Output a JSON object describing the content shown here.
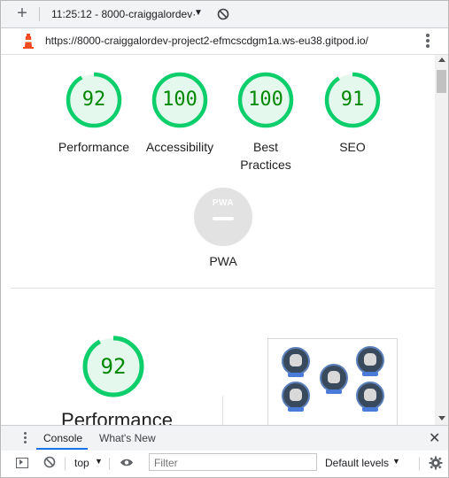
{
  "toolbar": {
    "plus_label": "+",
    "session_title": "11:25:12 - 8000-craiggalordev·",
    "caret": "▼"
  },
  "url_bar": {
    "url": "https://8000-craiggalordev-project2-efmcscdgm1a.ws-eu38.gitpod.io/"
  },
  "scores": [
    {
      "value": "92",
      "label": "Performance",
      "fraction": 0.92
    },
    {
      "value": "100",
      "label": "Accessibility",
      "fraction": 1.0
    },
    {
      "value": "100",
      "label": "Best Practices",
      "fraction": 1.0
    },
    {
      "value": "91",
      "label": "SEO",
      "fraction": 0.91
    }
  ],
  "pwa": {
    "logo": "PWA",
    "label": "PWA"
  },
  "performance_section": {
    "score": "92",
    "fraction": 0.92,
    "heading": "Performance"
  },
  "colors": {
    "pass": "#0cce6b",
    "pass_text": "#008800",
    "pass_bg": "#e5f8ee",
    "pwa_gray": "#e2e2e2",
    "accent_blue": "#1a73e8"
  },
  "drawer": {
    "tabs": [
      "Console",
      "What's New"
    ],
    "active_tab": "Console",
    "close": "✕"
  },
  "console_toolbar": {
    "context": "top",
    "context_caret": "▼",
    "filter_placeholder": "Filter",
    "levels": "Default levels",
    "levels_caret": "▼"
  }
}
